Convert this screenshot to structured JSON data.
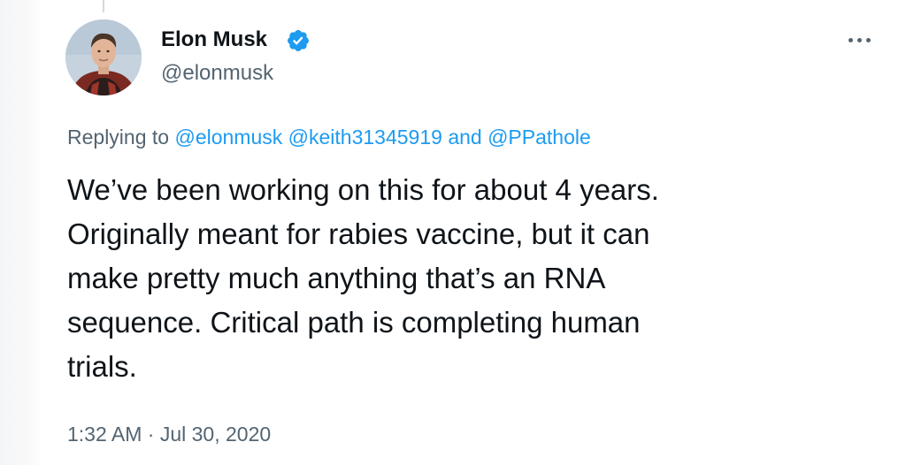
{
  "tweet": {
    "author": {
      "display_name": "Elon Musk",
      "handle": "@elonmusk",
      "verified": true
    },
    "replying": {
      "prefix": "Replying to ",
      "mention_1": "@elonmusk",
      "mention_2": "@keith31345919",
      "conjunction": "and",
      "mention_3": "@PPathole"
    },
    "text": "We’ve been working on this for about 4 years.\nOriginally meant for rabies vaccine, but it can\nmake pretty much anything that’s an RNA\nsequence. Critical path is completing human\ntrials.",
    "time": "1:32 AM",
    "separator": "·",
    "date": "Jul 30, 2020"
  },
  "icons": {
    "verified": "verified-badge-icon",
    "more": "more-options-icon"
  },
  "colors": {
    "link": "#1d9bf0",
    "secondary_text": "#536471",
    "primary_text": "#0f1419",
    "verified": "#1d9bf0"
  }
}
